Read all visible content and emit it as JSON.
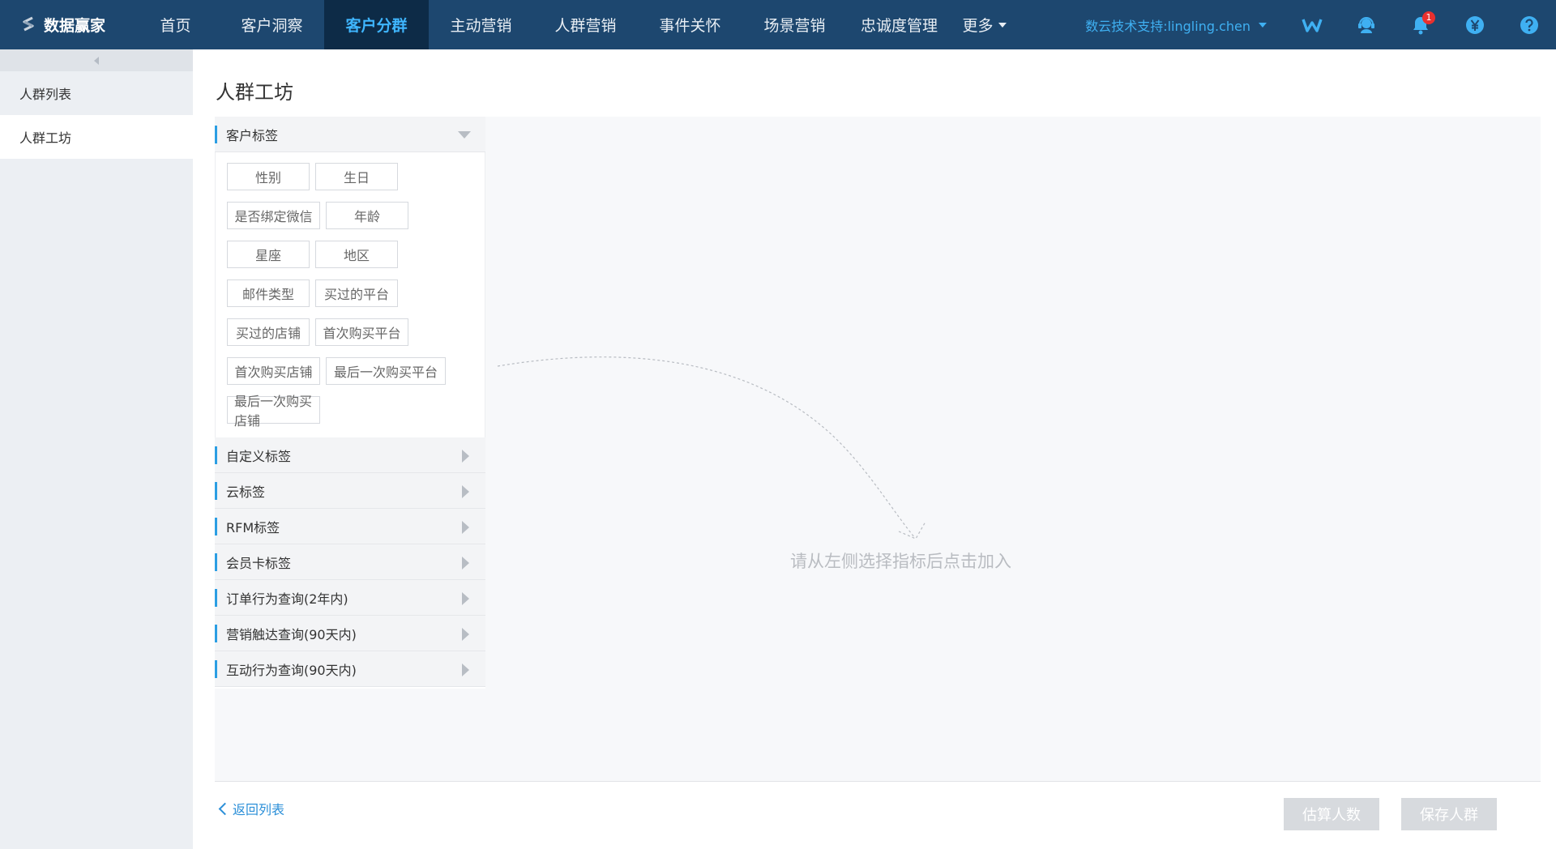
{
  "app": {
    "logo_text": "数据赢家"
  },
  "nav": {
    "items": [
      {
        "label": "首页",
        "width": 109
      },
      {
        "label": "客户洞察",
        "width": 129
      },
      {
        "label": "客户分群",
        "width": 129,
        "active": true
      },
      {
        "label": "主动营销",
        "width": 129
      },
      {
        "label": "人群营销",
        "width": 129
      },
      {
        "label": "事件关怀",
        "width": 129
      },
      {
        "label": "场景营销",
        "width": 129
      },
      {
        "label": "忠诚度管理",
        "width": 129
      }
    ],
    "more_label": "更多"
  },
  "top_right": {
    "support_label": "数云技术支持:lingling.chen",
    "notification_count": "1",
    "icons": [
      "w-logo-icon",
      "service-icon",
      "bell-icon",
      "yen-icon",
      "help-icon"
    ]
  },
  "sidebar": {
    "items": [
      {
        "label": "人群列表",
        "active": false
      },
      {
        "label": "人群工坊",
        "active": true
      }
    ]
  },
  "main": {
    "title": "人群工坊",
    "customer_tags": {
      "title": "客户标签",
      "rows": [
        [
          "性别",
          "生日"
        ],
        [
          "是否绑定微信",
          "年龄"
        ],
        [
          "星座",
          "地区"
        ],
        [
          "邮件类型",
          "买过的平台"
        ],
        [
          "买过的店铺",
          "首次购买平台"
        ],
        [
          "首次购买店铺",
          "最后一次购买平台"
        ],
        [
          "最后一次购买店铺"
        ]
      ]
    },
    "sections": [
      "自定义标签",
      "云标签",
      "RFM标签",
      "会员卡标签",
      "订单行为查询(2年内)",
      "营销触达查询(90天内)",
      "互动行为查询(90天内)"
    ],
    "drop_hint": "请从左侧选择指标后点击加入"
  },
  "footer": {
    "back_label": "返回列表",
    "estimate_label": "估算人数",
    "save_label": "保存人群"
  },
  "colors": {
    "topbar": "#1d476f",
    "nav_active_bg": "#0d2b47",
    "nav_active_text": "#3fb6ff",
    "accent": "#2b9ee3",
    "badge": "#e8302e",
    "disabled_button": "#d7dade"
  }
}
